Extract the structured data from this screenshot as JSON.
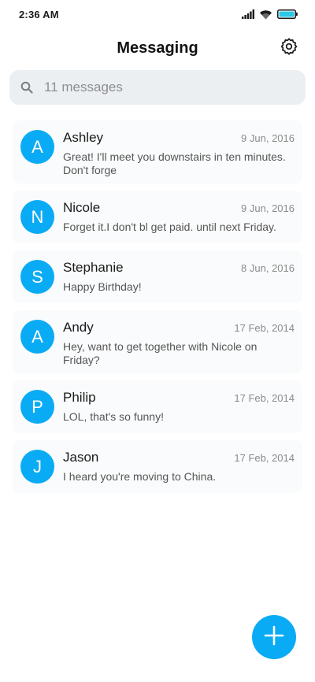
{
  "status_bar": {
    "time": "2:36 AM",
    "icons": [
      "signal-icon",
      "wifi-icon",
      "battery-icon"
    ],
    "battery_color": "#2bc8e8"
  },
  "header": {
    "title": "Messaging",
    "settings_icon": "gear-icon"
  },
  "search": {
    "placeholder": "11 messages",
    "value": "",
    "icon": "search-icon"
  },
  "theme": {
    "accent": "#0aabf5",
    "item_background": "#fafbfc",
    "search_background": "#eceff2"
  },
  "messages": [
    {
      "initial": "A",
      "name": "Ashley",
      "date": "9 Jun, 2016",
      "preview": "Great! I'll meet you downstairs in ten minutes. Don't forge"
    },
    {
      "initial": "N",
      "name": "Nicole",
      "date": "9 Jun, 2016",
      "preview": "Forget it.I don't bl get paid. until next Friday."
    },
    {
      "initial": "S",
      "name": "Stephanie",
      "date": "8 Jun, 2016",
      "preview": "Happy Birthday!"
    },
    {
      "initial": "A",
      "name": "Andy",
      "date": "17 Feb, 2014",
      "preview": "Hey, want to get together with Nicole on Friday?"
    },
    {
      "initial": "P",
      "name": "Philip",
      "date": "17 Feb, 2014",
      "preview": "LOL, that's so funny!"
    },
    {
      "initial": "J",
      "name": "Jason",
      "date": "17 Feb, 2014",
      "preview": "I heard you're moving to China."
    }
  ],
  "fab": {
    "icon": "plus-icon"
  }
}
